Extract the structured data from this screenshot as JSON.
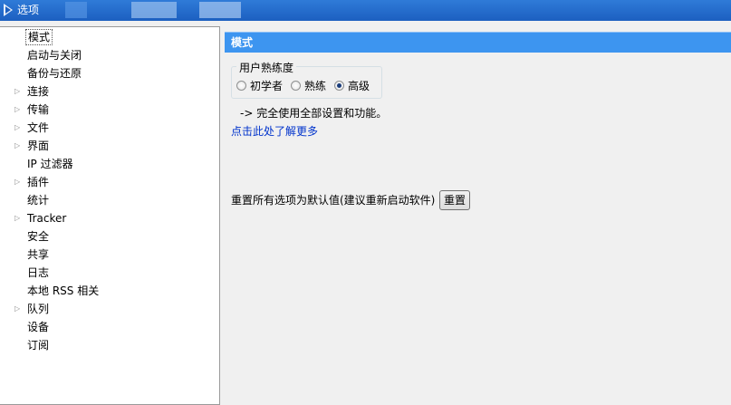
{
  "window": {
    "title": "选项"
  },
  "tree": {
    "items": [
      {
        "label": "模式",
        "has_arrow": false,
        "selected": true
      },
      {
        "label": "启动与关闭",
        "has_arrow": false
      },
      {
        "label": "备份与还原",
        "has_arrow": false
      },
      {
        "label": "连接",
        "has_arrow": true
      },
      {
        "label": "传输",
        "has_arrow": true
      },
      {
        "label": "文件",
        "has_arrow": true
      },
      {
        "label": "界面",
        "has_arrow": true
      },
      {
        "label": "IP 过滤器",
        "has_arrow": false
      },
      {
        "label": "插件",
        "has_arrow": true
      },
      {
        "label": "统计",
        "has_arrow": false
      },
      {
        "label": "Tracker",
        "has_arrow": true
      },
      {
        "label": "安全",
        "has_arrow": false
      },
      {
        "label": "共享",
        "has_arrow": false
      },
      {
        "label": "日志",
        "has_arrow": false
      },
      {
        "label": "本地 RSS 相关",
        "has_arrow": false
      },
      {
        "label": "队列",
        "has_arrow": true
      },
      {
        "label": "设备",
        "has_arrow": false
      },
      {
        "label": "订阅",
        "has_arrow": false
      }
    ]
  },
  "main": {
    "header": "模式",
    "proficiency": {
      "group_label": "用户熟练度",
      "options": [
        {
          "label": "初学者",
          "checked": false
        },
        {
          "label": "熟练",
          "checked": false
        },
        {
          "label": "高级",
          "checked": true
        }
      ]
    },
    "description": "-> 完全使用全部设置和功能。",
    "learn_more_link": "点击此处了解更多",
    "reset_text": "重置所有选项为默认值(建议重新启动软件)",
    "reset_button": "重置"
  },
  "colors": {
    "header_bg": "#3d95f0",
    "link": "#0033cc",
    "titlebar": "#2f7bd8"
  }
}
